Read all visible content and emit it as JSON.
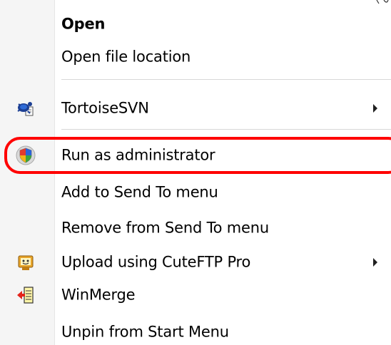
{
  "context_menu": {
    "items": [
      {
        "label": "Open",
        "bold": true
      },
      {
        "label": "Open file location"
      },
      {
        "label": "TortoiseSVN",
        "icon": "tortoisesvn-icon",
        "submenu": true
      },
      {
        "label": "Run as administrator",
        "icon": "uac-shield-icon",
        "highlighted": true
      },
      {
        "label": "Add to Send To menu"
      },
      {
        "label": "Remove from Send To menu"
      },
      {
        "label": "Upload using CuteFTP Pro",
        "icon": "cuteftp-icon",
        "submenu": true
      },
      {
        "label": "WinMerge",
        "icon": "winmerge-icon"
      },
      {
        "label": "Unpin from Start Menu"
      }
    ]
  },
  "annotation": {
    "highlight_color": "#ff0000"
  },
  "colors": {
    "gutter": "#f5f5f5",
    "separator": "#d8d8d8",
    "text": "#000000"
  }
}
